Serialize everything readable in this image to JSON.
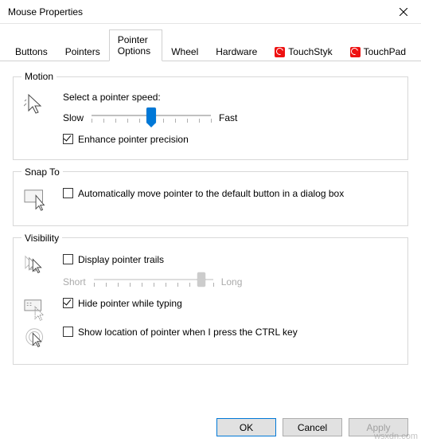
{
  "window": {
    "title": "Mouse Properties"
  },
  "tabs": [
    {
      "label": "Buttons"
    },
    {
      "label": "Pointers"
    },
    {
      "label": "Pointer Options"
    },
    {
      "label": "Wheel"
    },
    {
      "label": "Hardware"
    },
    {
      "label": "TouchStyk"
    },
    {
      "label": "TouchPad"
    }
  ],
  "motion": {
    "legend": "Motion",
    "select_label": "Select a pointer speed:",
    "slow": "Slow",
    "fast": "Fast",
    "speed_value": 6,
    "speed_max": 11,
    "enhance_label": "Enhance pointer precision",
    "enhance_checked": true
  },
  "snap": {
    "legend": "Snap To",
    "auto_label": "Automatically move pointer to the default button in a dialog box",
    "auto_checked": false
  },
  "visibility": {
    "legend": "Visibility",
    "trails_label": "Display pointer trails",
    "trails_checked": false,
    "short": "Short",
    "long": "Long",
    "trails_value": 10,
    "trails_max": 11,
    "hide_label": "Hide pointer while typing",
    "hide_checked": true,
    "ctrl_label": "Show location of pointer when I press the CTRL key",
    "ctrl_checked": false
  },
  "buttons": {
    "ok": "OK",
    "cancel": "Cancel",
    "apply": "Apply"
  },
  "watermark": "wsxdn.com"
}
